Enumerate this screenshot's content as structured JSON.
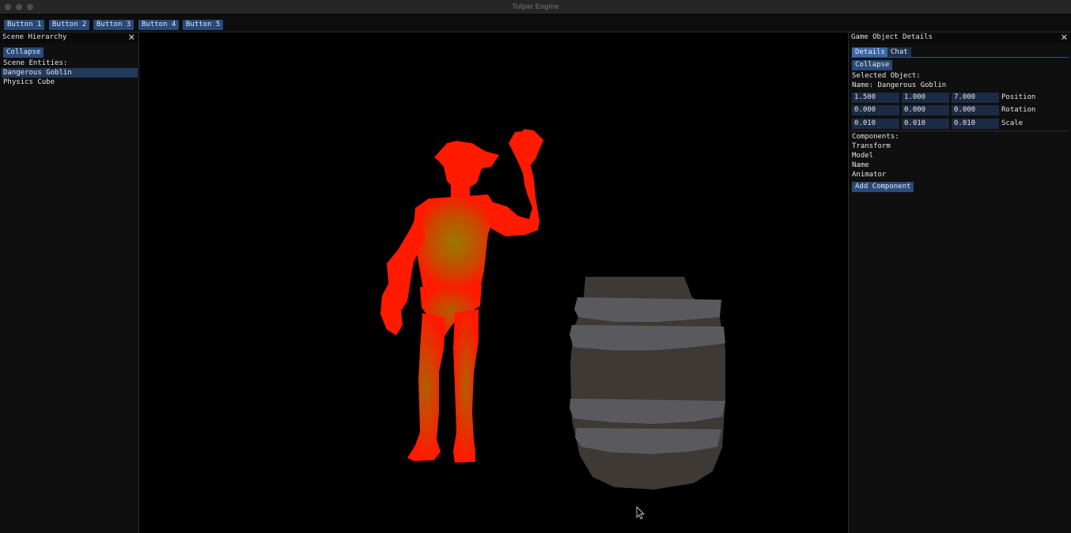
{
  "app": {
    "title": "Tulpar Engine"
  },
  "toolbar": {
    "buttons": [
      "Button 1",
      "Button 2",
      "Button 3",
      "Button 4",
      "Button 5"
    ]
  },
  "scene_hierarchy": {
    "title": "Scene Hierarchy",
    "collapse_label": "Collapse",
    "entities_label": "Scene Entities:",
    "entities": [
      "Dangerous Goblin",
      "Physics Cube"
    ],
    "selected_index": 0
  },
  "details_panel": {
    "title": "Game Object Details",
    "tabs": [
      "Details",
      "Chat"
    ],
    "active_tab": "Details",
    "collapse_label": "Collapse",
    "selected_label": "Selected Object:",
    "name_line": "Name: Dangerous Goblin",
    "transform": {
      "position": {
        "label": "Position",
        "x": "1.500",
        "y": "1.000",
        "z": "7.000"
      },
      "rotation": {
        "label": "Rotation",
        "x": "0.000",
        "y": "0.000",
        "z": "0.000"
      },
      "scale": {
        "label": "Scale",
        "x": "0.010",
        "y": "0.010",
        "z": "0.010"
      }
    },
    "components_label": "Components:",
    "components": [
      "Transform",
      "Model",
      "Name",
      "Animator"
    ],
    "add_component_label": "Add Component"
  },
  "colors": {
    "button_bg": "#294a7a",
    "selection_bg": "#233a5c",
    "tab_active": "#3a67a8",
    "goblin": "#ff1a00",
    "barrel_body": "#3e3935",
    "barrel_bands": "#5a5a5e"
  },
  "viewport": {
    "objects": [
      "goblin-model",
      "barrel-model",
      "mouse-cursor"
    ]
  }
}
